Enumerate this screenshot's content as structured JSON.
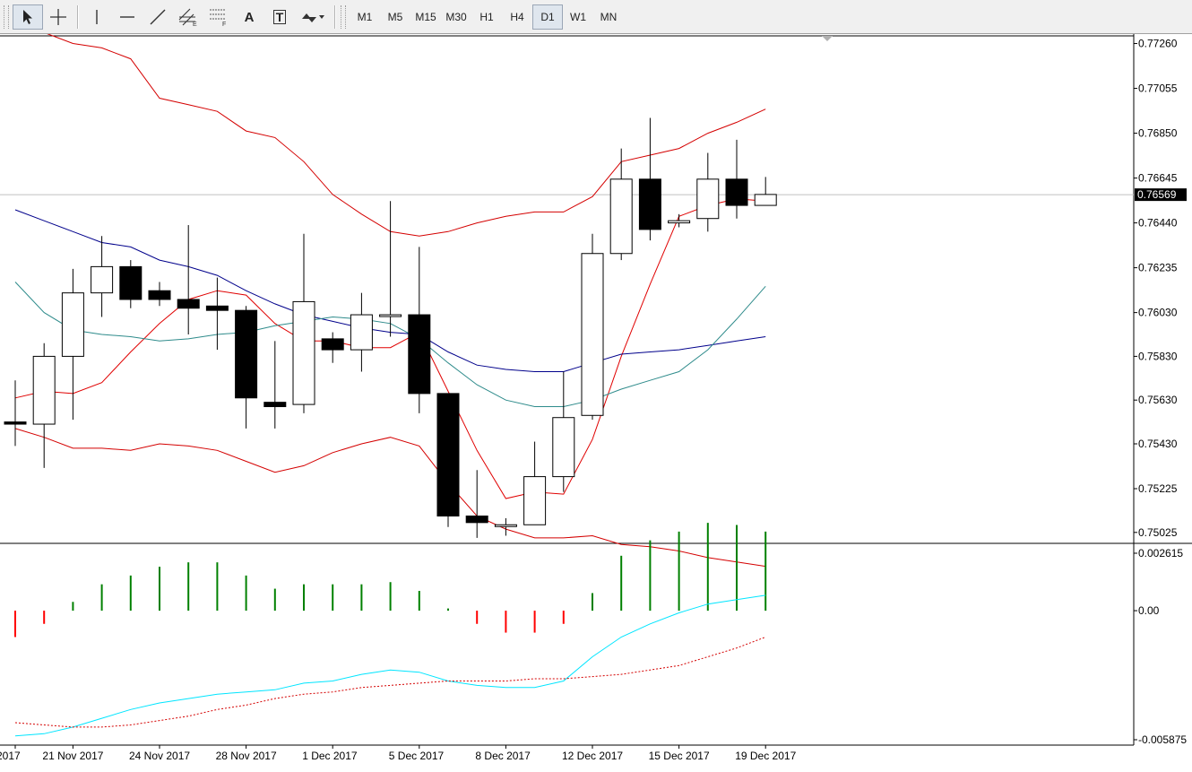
{
  "toolbar": {
    "tools": [
      {
        "icon": "cursor-arrow-icon",
        "glyph": "",
        "active": true
      },
      {
        "icon": "crosshair-icon",
        "glyph": "",
        "active": false
      },
      {
        "icon": "vertical-line-icon",
        "glyph": "",
        "active": false
      },
      {
        "icon": "horizontal-line-icon",
        "glyph": "",
        "active": false
      },
      {
        "icon": "trendline-icon",
        "glyph": "",
        "active": false
      },
      {
        "icon": "equidistant-channel-icon",
        "glyph": "",
        "active": false
      },
      {
        "icon": "fibonacci-retracement-icon",
        "glyph": "",
        "active": false
      },
      {
        "icon": "text-icon",
        "glyph": "A",
        "active": false
      },
      {
        "icon": "text-label-icon",
        "glyph": "T",
        "active": false
      },
      {
        "icon": "arrows-dropdown-icon",
        "glyph": "",
        "active": false
      }
    ],
    "timeframes": [
      "M1",
      "M5",
      "M15",
      "M30",
      "H1",
      "H4",
      "D1",
      "W1",
      "MN"
    ],
    "active_timeframe": "D1"
  },
  "chart_data": [
    {
      "type": "candlestick",
      "title": "",
      "ylim": [
        0.74975,
        0.77295
      ],
      "y_ticks": [
        "0.77260",
        "0.77055",
        "0.76850",
        "0.76645",
        "0.76440",
        "0.76235",
        "0.76030",
        "0.75830",
        "0.75630",
        "0.75430",
        "0.75225",
        "0.75025"
      ],
      "current_price": "0.76569",
      "x_labels": [
        "2017",
        "21 Nov 2017",
        "24 Nov 2017",
        "28 Nov 2017",
        "1 Dec 2017",
        "5 Dec 2017",
        "8 Dec 2017",
        "12 Dec 2017",
        "15 Dec 2017",
        "19 Dec 2017"
      ],
      "candles": [
        {
          "o": 0.7553,
          "h": 0.7572,
          "l": 0.7542,
          "c": 0.7552
        },
        {
          "o": 0.7552,
          "h": 0.7589,
          "l": 0.7532,
          "c": 0.7583
        },
        {
          "o": 0.7583,
          "h": 0.7623,
          "l": 0.7554,
          "c": 0.7612
        },
        {
          "o": 0.7612,
          "h": 0.7638,
          "l": 0.7601,
          "c": 0.7624
        },
        {
          "o": 0.7624,
          "h": 0.7627,
          "l": 0.7605,
          "c": 0.7609
        },
        {
          "o": 0.7613,
          "h": 0.7617,
          "l": 0.7606,
          "c": 0.7609
        },
        {
          "o": 0.7609,
          "h": 0.7643,
          "l": 0.7593,
          "c": 0.7605
        },
        {
          "o": 0.7606,
          "h": 0.7619,
          "l": 0.7586,
          "c": 0.7604
        },
        {
          "o": 0.7604,
          "h": 0.7606,
          "l": 0.755,
          "c": 0.7564
        },
        {
          "o": 0.7562,
          "h": 0.759,
          "l": 0.755,
          "c": 0.756
        },
        {
          "o": 0.7561,
          "h": 0.7639,
          "l": 0.7557,
          "c": 0.7608
        },
        {
          "o": 0.7591,
          "h": 0.7594,
          "l": 0.758,
          "c": 0.7586
        },
        {
          "o": 0.7586,
          "h": 0.7612,
          "l": 0.7576,
          "c": 0.7602
        },
        {
          "o": 0.7602,
          "h": 0.7654,
          "l": 0.7592,
          "c": 0.7602
        },
        {
          "o": 0.7602,
          "h": 0.7633,
          "l": 0.7557,
          "c": 0.7566
        },
        {
          "o": 0.7566,
          "h": 0.7566,
          "l": 0.7505,
          "c": 0.751
        },
        {
          "o": 0.751,
          "h": 0.7531,
          "l": 0.75,
          "c": 0.7507
        },
        {
          "o": 0.7506,
          "h": 0.7509,
          "l": 0.7501,
          "c": 0.7506
        },
        {
          "o": 0.7506,
          "h": 0.7544,
          "l": 0.7506,
          "c": 0.7528
        },
        {
          "o": 0.7528,
          "h": 0.7576,
          "l": 0.7521,
          "c": 0.7555
        },
        {
          "o": 0.7556,
          "h": 0.7639,
          "l": 0.7554,
          "c": 0.763
        },
        {
          "o": 0.763,
          "h": 0.7678,
          "l": 0.7627,
          "c": 0.7664
        },
        {
          "o": 0.7664,
          "h": 0.7692,
          "l": 0.7636,
          "c": 0.7641
        },
        {
          "o": 0.7644,
          "h": 0.7648,
          "l": 0.7642,
          "c": 0.7645
        },
        {
          "o": 0.7646,
          "h": 0.7676,
          "l": 0.764,
          "c": 0.7664
        },
        {
          "o": 0.7664,
          "h": 0.7682,
          "l": 0.7646,
          "c": 0.7652
        },
        {
          "o": 0.7652,
          "h": 0.7665,
          "l": 0.7652,
          "c": 0.7657
        }
      ],
      "overlays": [
        {
          "name": "",
          "color": "#d40000",
          "values": [
            0.7732,
            0.7731,
            0.7726,
            0.7724,
            0.7719,
            0.7701,
            0.7698,
            0.7695,
            0.7686,
            0.7683,
            0.7672,
            0.7657,
            0.7648,
            0.764,
            0.7638,
            0.764,
            0.7644,
            0.7647,
            0.7649,
            0.7649,
            0.7656,
            0.7672,
            0.7675,
            0.7678,
            0.7685,
            0.769,
            0.7696
          ]
        },
        {
          "name": "",
          "color": "#d40000",
          "values": [
            0.755,
            0.7546,
            0.7541,
            0.7541,
            0.754,
            0.7543,
            0.7542,
            0.754,
            0.7535,
            0.753,
            0.7533,
            0.7539,
            0.7543,
            0.7546,
            0.7542,
            0.7525,
            0.751,
            0.7504,
            0.75,
            0.75,
            0.7501,
            0.7497,
            0.7496,
            0.7494,
            0.7491,
            0.7489,
            0.7487
          ]
        },
        {
          "name": "",
          "color": "#e00000",
          "values": [
            0.7564,
            0.7567,
            0.7566,
            0.7571,
            0.7585,
            0.7598,
            0.7609,
            0.7613,
            0.7611,
            0.7598,
            0.759,
            0.759,
            0.7587,
            0.7587,
            0.7594,
            0.7567,
            0.754,
            0.7518,
            0.7521,
            0.752,
            0.7545,
            0.7583,
            0.7616,
            0.7647,
            0.7652,
            0.7655,
            0.7654
          ]
        },
        {
          "name": "",
          "color": "#00008b",
          "values": [
            0.765,
            0.7645,
            0.764,
            0.7635,
            0.7633,
            0.7627,
            0.7624,
            0.762,
            0.7613,
            0.7607,
            0.7602,
            0.7599,
            0.7596,
            0.7594,
            0.7593,
            0.7585,
            0.7579,
            0.7577,
            0.7576,
            0.7576,
            0.758,
            0.7584,
            0.7585,
            0.7586,
            0.7588,
            0.759,
            0.7592
          ]
        },
        {
          "name": "",
          "color": "#2e8b8b",
          "values": [
            0.7617,
            0.7603,
            0.7595,
            0.7593,
            0.7592,
            0.759,
            0.7591,
            0.7593,
            0.7594,
            0.7597,
            0.7599,
            0.7601,
            0.76,
            0.7598,
            0.7591,
            0.758,
            0.757,
            0.7563,
            0.756,
            0.756,
            0.7563,
            0.7568,
            0.7572,
            0.7576,
            0.7586,
            0.76,
            0.7615
          ]
        }
      ]
    },
    {
      "type": "histogram",
      "title": "",
      "ylim": [
        -0.005875,
        0.002615
      ],
      "y_ticks": [
        "0.002615",
        "0.00",
        "-0.005875"
      ],
      "bars": [
        -0.0012,
        -0.0006,
        0.0004,
        0.0012,
        0.0016,
        0.002,
        0.0022,
        0.0022,
        0.0016,
        0.001,
        0.0012,
        0.0012,
        0.0012,
        0.0013,
        0.0009,
        0.0001,
        -0.0006,
        -0.001,
        -0.001,
        -0.0006,
        0.0008,
        0.0025,
        0.0032,
        0.0036,
        0.004,
        0.0039,
        0.0036
      ],
      "bar_colors": {
        "positive": "#008000",
        "negative": "#ff0000"
      },
      "signal_main": {
        "color": "#00e5ff",
        "values": [
          -0.0057,
          -0.0056,
          -0.0053,
          -0.0049,
          -0.0045,
          -0.0042,
          -0.004,
          -0.0038,
          -0.0037,
          -0.0036,
          -0.0033,
          -0.0032,
          -0.0029,
          -0.0027,
          -0.0028,
          -0.0032,
          -0.0034,
          -0.0035,
          -0.0035,
          -0.0032,
          -0.0021,
          -0.0012,
          -0.0006,
          -0.0001,
          0.0003,
          0.0005,
          0.0007
        ]
      },
      "signal_dotted": {
        "color": "#d40000",
        "values": [
          -0.0051,
          -0.0052,
          -0.0053,
          -0.0053,
          -0.0052,
          -0.005,
          -0.0048,
          -0.0045,
          -0.0043,
          -0.004,
          -0.0038,
          -0.0037,
          -0.0035,
          -0.0034,
          -0.0033,
          -0.0032,
          -0.0032,
          -0.0032,
          -0.0031,
          -0.0031,
          -0.003,
          -0.0029,
          -0.0027,
          -0.0025,
          -0.0021,
          -0.0017,
          -0.0012
        ]
      }
    }
  ]
}
